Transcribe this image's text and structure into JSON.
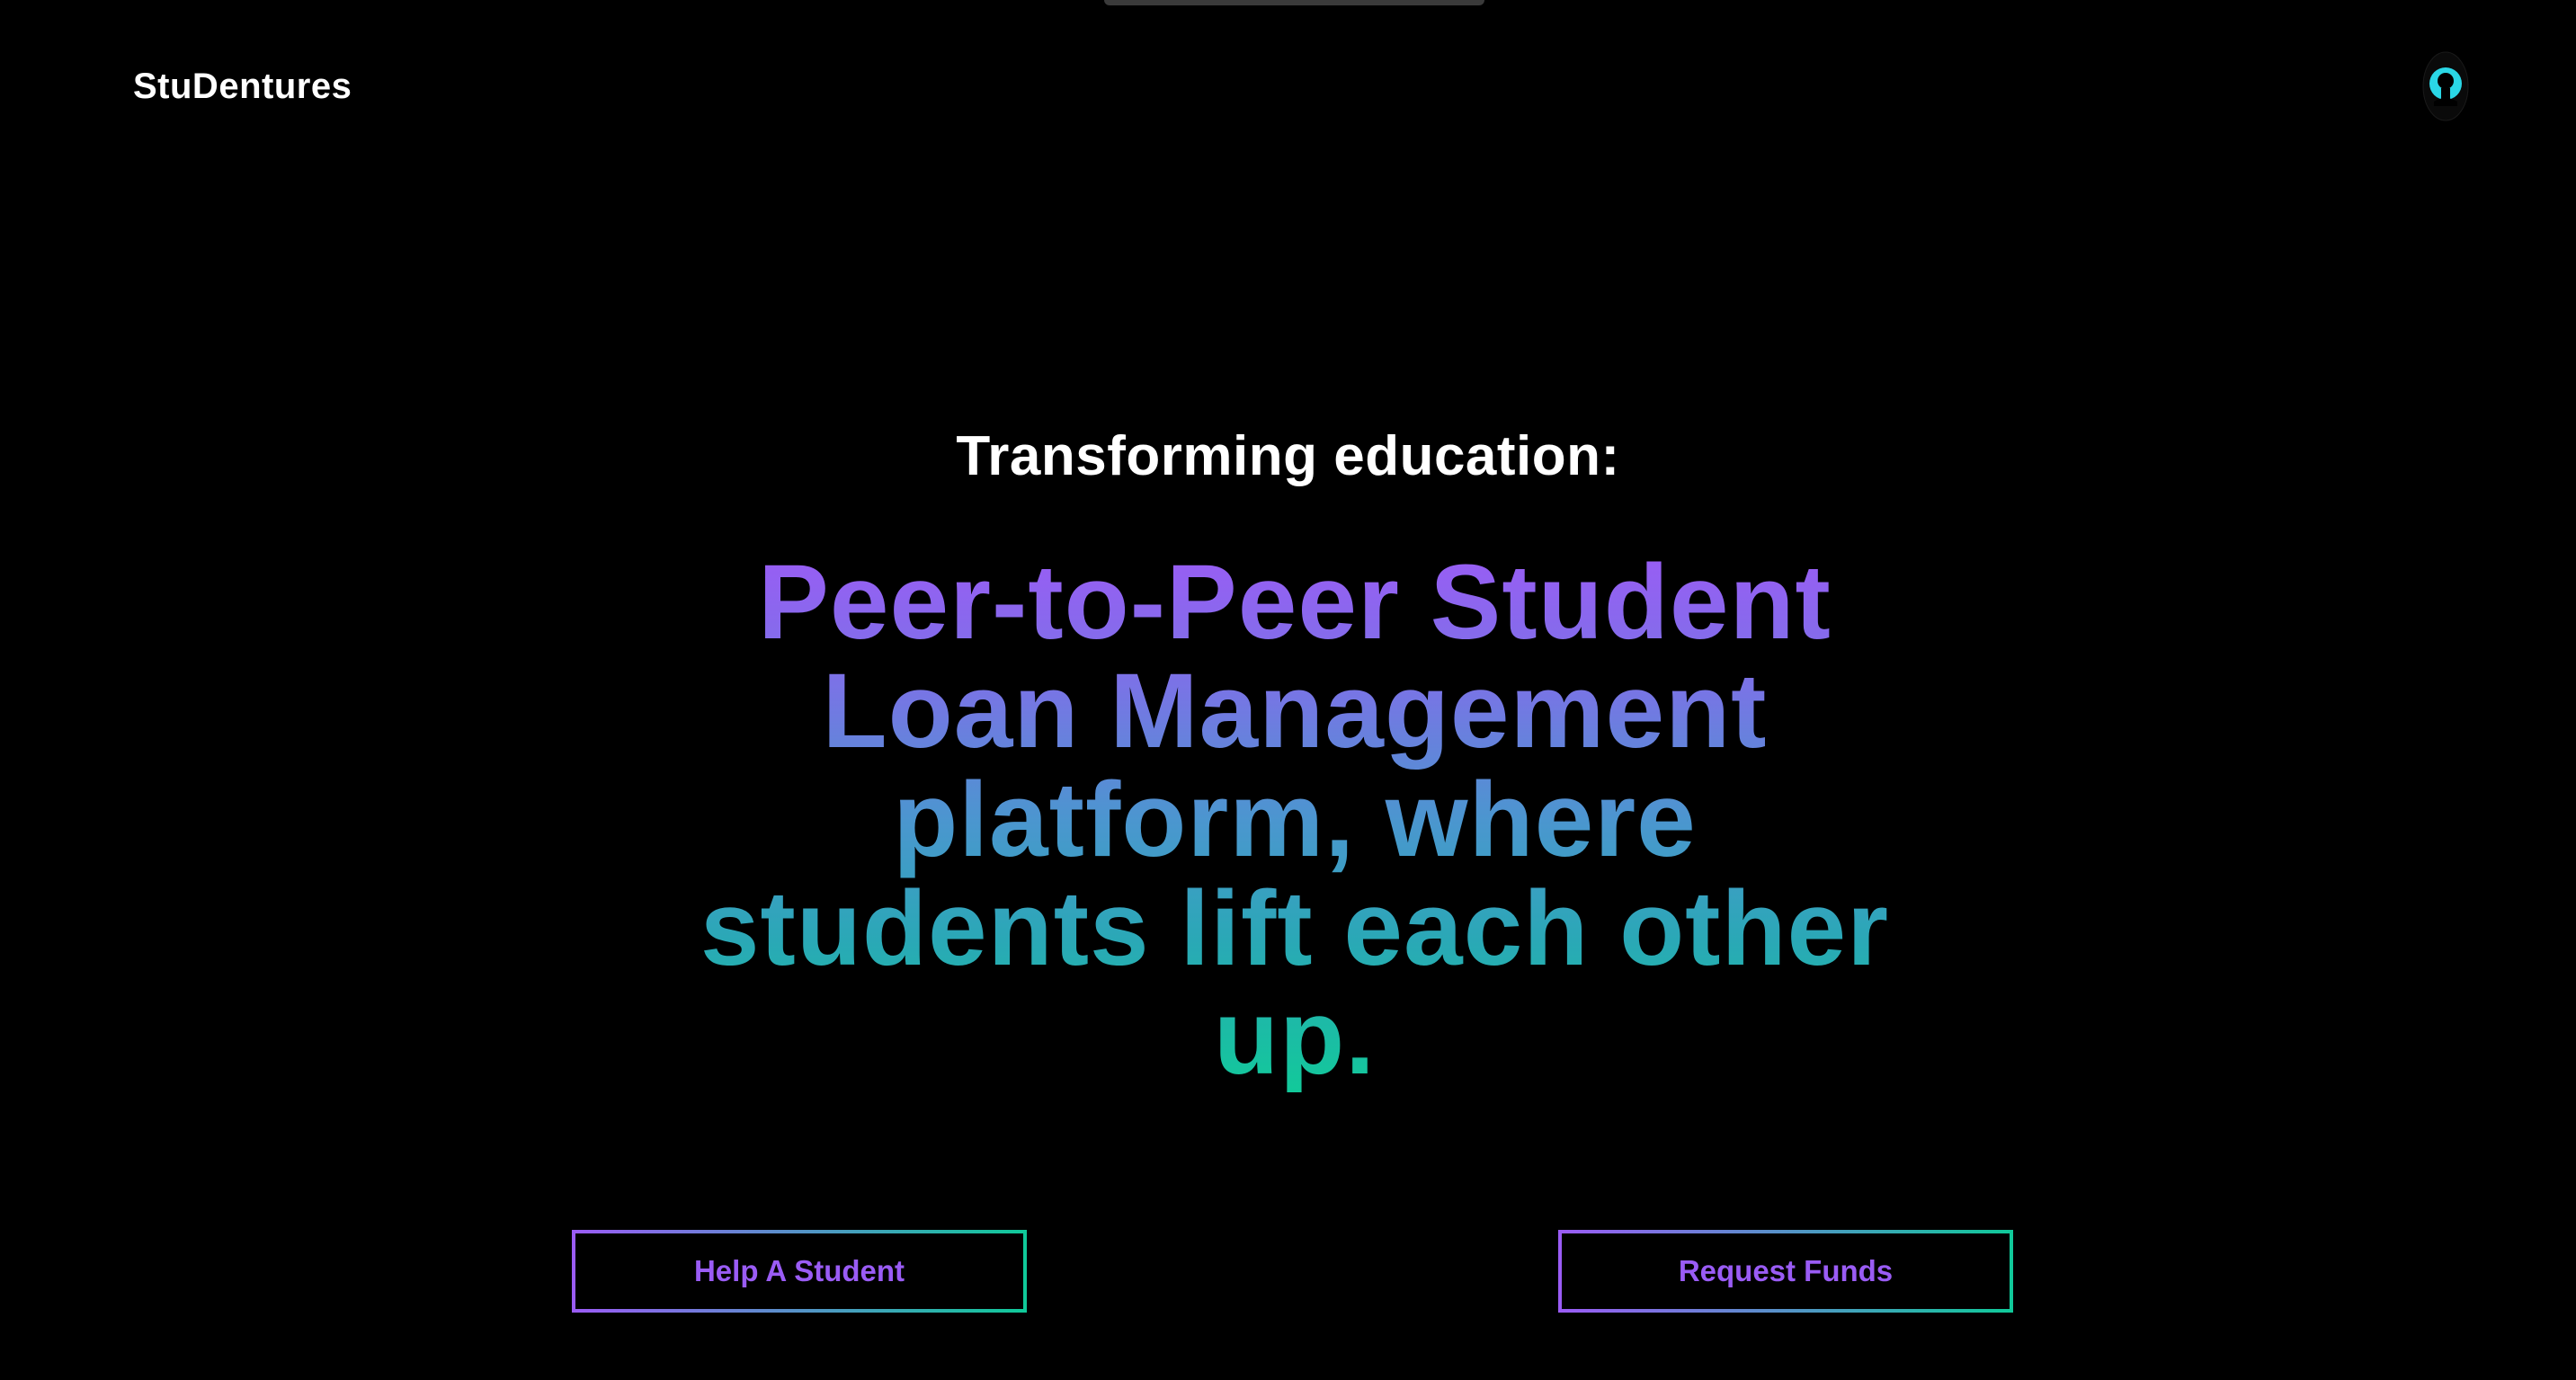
{
  "header": {
    "brand": "StuDentures",
    "profile_icon": "user-avatar-icon"
  },
  "hero": {
    "eyebrow": "Transforming education:",
    "headline_lines": [
      "Peer-to-Peer Student",
      "Loan Management",
      "platform, where",
      "students lift each other",
      "up."
    ]
  },
  "actions": {
    "help_label": "Help A Student",
    "request_label": "Request Funds"
  },
  "colors": {
    "background": "#000000",
    "gradient_start": "#9a5cf5",
    "gradient_end": "#12c99a",
    "accent_cyan": "#2ad7e6",
    "text_primary": "#ffffff"
  }
}
